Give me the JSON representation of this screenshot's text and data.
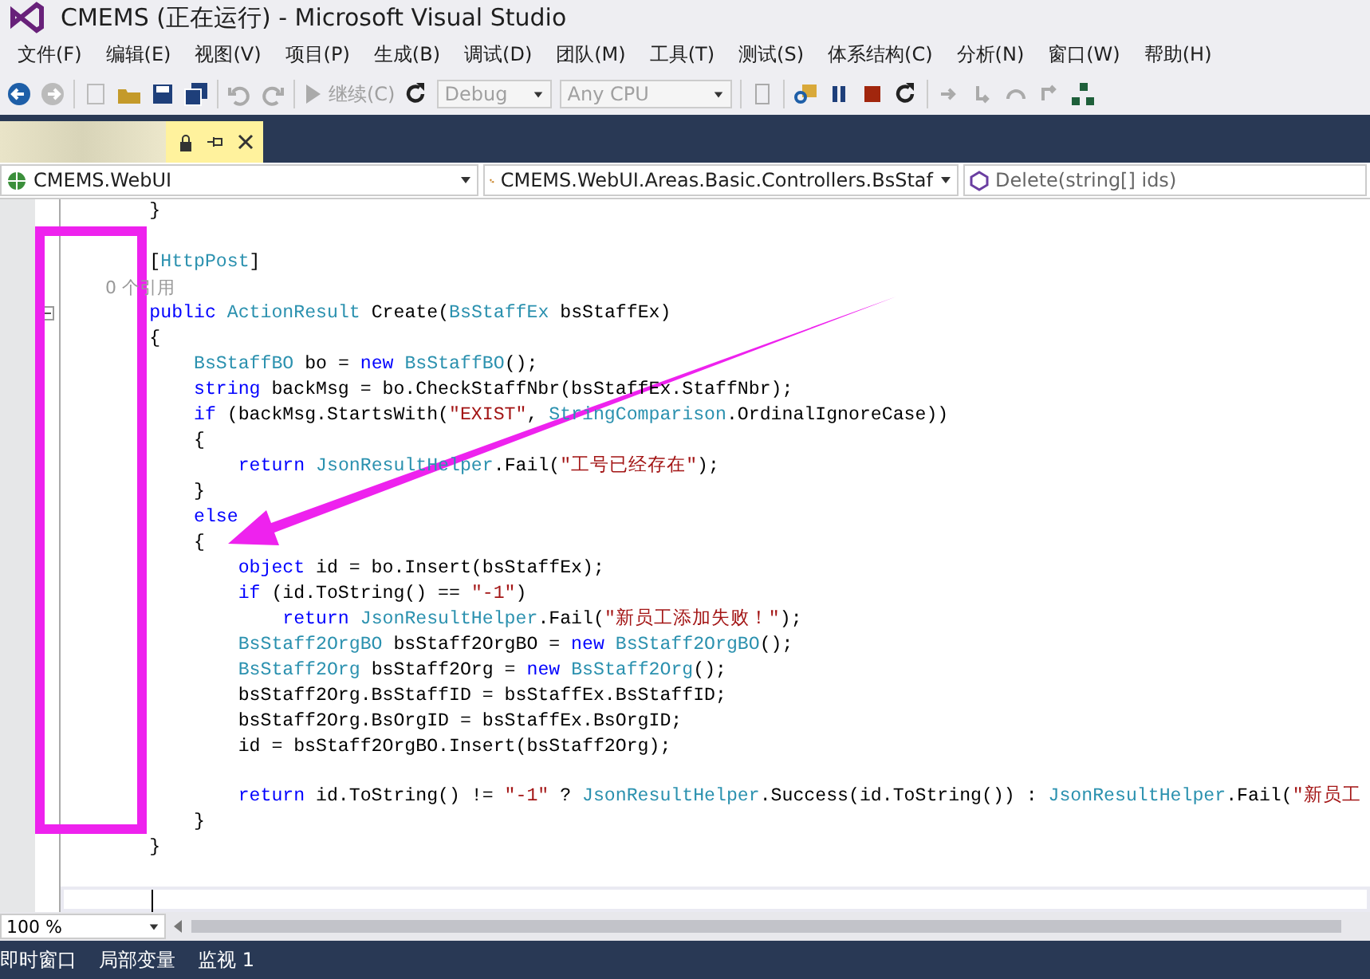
{
  "window": {
    "title": "CMEMS (正在运行) - Microsoft Visual Studio"
  },
  "menu": [
    "文件(F)",
    "编辑(E)",
    "视图(V)",
    "项目(P)",
    "生成(B)",
    "调试(D)",
    "团队(M)",
    "工具(T)",
    "测试(S)",
    "体系结构(C)",
    "分析(N)",
    "窗口(W)",
    "帮助(H)"
  ],
  "toolbar": {
    "continue": "继续(C)",
    "configuration": "Debug",
    "platform": "Any CPU"
  },
  "nav_bar": {
    "project": "CMEMS.WebUI",
    "type": "CMEMS.WebUI.Areas.Basic.Controllers.BsStaf",
    "member": "Delete(string[] ids)"
  },
  "editor": {
    "lines": [
      {
        "kind": "code",
        "tokens": [
          {
            "kind": "plain",
            "text": "        }"
          }
        ]
      },
      {
        "kind": "blank"
      },
      {
        "kind": "code",
        "tokens": [
          {
            "kind": "plain",
            "text": "        ["
          },
          {
            "kind": "type",
            "text": "HttpPost"
          },
          {
            "kind": "plain",
            "text": "]"
          }
        ]
      },
      {
        "kind": "lens",
        "tokens": [
          {
            "kind": "plain",
            "text": "        0 个引用"
          }
        ]
      },
      {
        "kind": "code",
        "fold": true,
        "tokens": [
          {
            "kind": "keyword",
            "text": "        public "
          },
          {
            "kind": "type",
            "text": "ActionResult"
          },
          {
            "kind": "plain",
            "text": " Create("
          },
          {
            "kind": "type",
            "text": "BsStaffEx"
          },
          {
            "kind": "plain",
            "text": " bsStaffEx)"
          }
        ]
      },
      {
        "kind": "code",
        "tokens": [
          {
            "kind": "plain",
            "text": "        {"
          }
        ]
      },
      {
        "kind": "code",
        "tokens": [
          {
            "kind": "type",
            "text": "            BsStaffBO"
          },
          {
            "kind": "plain",
            "text": " bo = "
          },
          {
            "kind": "keyword",
            "text": "new "
          },
          {
            "kind": "type",
            "text": "BsStaffBO"
          },
          {
            "kind": "plain",
            "text": "();"
          }
        ]
      },
      {
        "kind": "code",
        "tokens": [
          {
            "kind": "keyword",
            "text": "            string"
          },
          {
            "kind": "plain",
            "text": " backMsg = bo.CheckStaffNbr(bsStaffEx.StaffNbr);"
          }
        ]
      },
      {
        "kind": "code",
        "tokens": [
          {
            "kind": "keyword",
            "text": "            if"
          },
          {
            "kind": "plain",
            "text": " (backMsg.StartsWith("
          },
          {
            "kind": "string",
            "text": "\"EXIST\""
          },
          {
            "kind": "plain",
            "text": ", "
          },
          {
            "kind": "type",
            "text": "StringComparison"
          },
          {
            "kind": "plain",
            "text": ".OrdinalIgnoreCase))"
          }
        ]
      },
      {
        "kind": "code",
        "tokens": [
          {
            "kind": "plain",
            "text": "            {"
          }
        ]
      },
      {
        "kind": "code",
        "tokens": [
          {
            "kind": "keyword",
            "text": "                return "
          },
          {
            "kind": "type",
            "text": "JsonResultHelper"
          },
          {
            "kind": "plain",
            "text": ".Fail("
          },
          {
            "kind": "string",
            "text": "\"工号已经存在\""
          },
          {
            "kind": "plain",
            "text": ");"
          }
        ]
      },
      {
        "kind": "code",
        "tokens": [
          {
            "kind": "plain",
            "text": "            }"
          }
        ]
      },
      {
        "kind": "code",
        "tokens": [
          {
            "kind": "keyword",
            "text": "            else"
          }
        ]
      },
      {
        "kind": "code",
        "tokens": [
          {
            "kind": "plain",
            "text": "            {"
          }
        ]
      },
      {
        "kind": "code",
        "tokens": [
          {
            "kind": "keyword",
            "text": "                object"
          },
          {
            "kind": "plain",
            "text": " id = bo.Insert(bsStaffEx);"
          }
        ]
      },
      {
        "kind": "code",
        "tokens": [
          {
            "kind": "keyword",
            "text": "                if"
          },
          {
            "kind": "plain",
            "text": " (id.ToString() == "
          },
          {
            "kind": "string",
            "text": "\"-1\""
          },
          {
            "kind": "plain",
            "text": ")"
          }
        ]
      },
      {
        "kind": "code",
        "tokens": [
          {
            "kind": "keyword",
            "text": "                    return "
          },
          {
            "kind": "type",
            "text": "JsonResultHelper"
          },
          {
            "kind": "plain",
            "text": ".Fail("
          },
          {
            "kind": "string",
            "text": "\"新员工添加失败！\""
          },
          {
            "kind": "plain",
            "text": ");"
          }
        ]
      },
      {
        "kind": "code",
        "tokens": [
          {
            "kind": "type",
            "text": "                BsStaff2OrgBO"
          },
          {
            "kind": "plain",
            "text": " bsStaff2OrgBO = "
          },
          {
            "kind": "keyword",
            "text": "new "
          },
          {
            "kind": "type",
            "text": "BsStaff2OrgBO"
          },
          {
            "kind": "plain",
            "text": "();"
          }
        ]
      },
      {
        "kind": "code",
        "tokens": [
          {
            "kind": "type",
            "text": "                BsStaff2Org"
          },
          {
            "kind": "plain",
            "text": " bsStaff2Org = "
          },
          {
            "kind": "keyword",
            "text": "new "
          },
          {
            "kind": "type",
            "text": "BsStaff2Org"
          },
          {
            "kind": "plain",
            "text": "();"
          }
        ]
      },
      {
        "kind": "code",
        "tokens": [
          {
            "kind": "plain",
            "text": "                bsStaff2Org.BsStaffID = bsStaffEx.BsStaffID;"
          }
        ]
      },
      {
        "kind": "code",
        "tokens": [
          {
            "kind": "plain",
            "text": "                bsStaff2Org.BsOrgID = bsStaffEx.BsOrgID;"
          }
        ]
      },
      {
        "kind": "code",
        "tokens": [
          {
            "kind": "plain",
            "text": "                id = bsStaff2OrgBO.Insert(bsStaff2Org);"
          }
        ]
      },
      {
        "kind": "blank"
      },
      {
        "kind": "code",
        "tokens": [
          {
            "kind": "keyword",
            "text": "                return"
          },
          {
            "kind": "plain",
            "text": " id.ToString() != "
          },
          {
            "kind": "string",
            "text": "\"-1\""
          },
          {
            "kind": "plain",
            "text": " ? "
          },
          {
            "kind": "type",
            "text": "JsonResultHelper"
          },
          {
            "kind": "plain",
            "text": ".Success(id.ToString()) : "
          },
          {
            "kind": "type",
            "text": "JsonResultHelper"
          },
          {
            "kind": "plain",
            "text": ".Fail("
          },
          {
            "kind": "string",
            "text": "\"新员工"
          }
        ]
      },
      {
        "kind": "code",
        "tokens": [
          {
            "kind": "plain",
            "text": "            }"
          }
        ]
      },
      {
        "kind": "code",
        "tokens": [
          {
            "kind": "plain",
            "text": "        }"
          }
        ]
      },
      {
        "kind": "blank"
      },
      {
        "kind": "cursor"
      }
    ]
  },
  "zoom": "100 %",
  "tool_tabs": [
    "即时窗口",
    "局部变量",
    "监视 1"
  ]
}
